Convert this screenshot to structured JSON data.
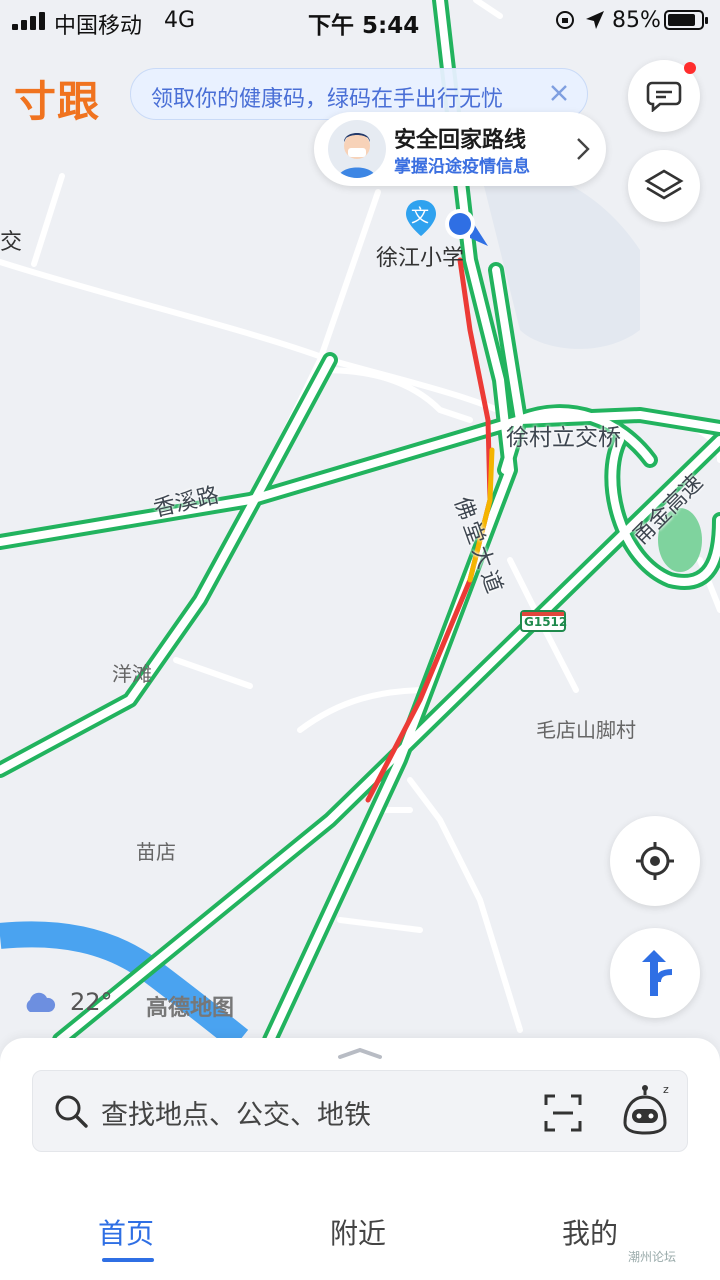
{
  "status_bar": {
    "carrier": "中国移动",
    "network": "4G",
    "time": "下午 5:44",
    "battery_percent": "85%",
    "battery_level": 0.85
  },
  "logo_fragment": "寸跟",
  "health_banner": {
    "text": "领取你的健康码，绿码在手出行无忧"
  },
  "route_card": {
    "title": "安全回家路线",
    "subtitle": "掌握沿途疫情信息"
  },
  "map_labels": {
    "school": "徐江小学",
    "interchange": "徐村立交桥",
    "road_xiangxi": "香溪路",
    "road_fotang": "佛堂大道",
    "expressway": "甬金高速",
    "shield": "G1512",
    "village_yangtan": "洋滩",
    "village_maodian": "毛店山脚村",
    "village_miaodian": "苗店",
    "partial_left": "交",
    "poi_icon_char": "文"
  },
  "weather": {
    "temperature": "22°",
    "icon": "cloud-icon"
  },
  "brand": "高德地图",
  "search": {
    "placeholder": "查找地点、公交、地铁"
  },
  "tabs": [
    {
      "label": "首页",
      "active": true
    },
    {
      "label": "附近",
      "active": false
    },
    {
      "label": "我的",
      "active": false
    }
  ],
  "watermark": "潮州论坛",
  "colors": {
    "road_green": "#22b35e",
    "congestion_red": "#ec3b36",
    "slow_yellow": "#f4b400",
    "accent_blue": "#2f6fe4",
    "river_blue": "#4aa3f0"
  }
}
